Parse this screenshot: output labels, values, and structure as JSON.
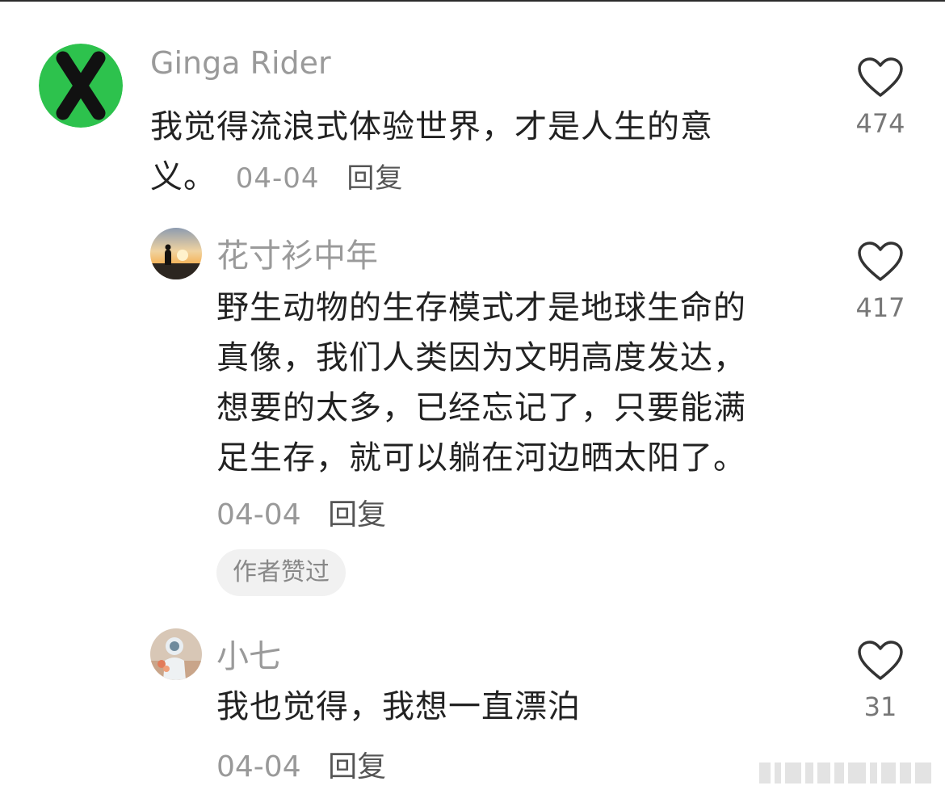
{
  "comments": [
    {
      "user": "Ginga Rider",
      "text_lines": [
        "我觉得流浪式体验世界，才是人生的意",
        "义。"
      ],
      "date": "04-04",
      "reply_label": "回复",
      "likes": "474",
      "avatar": "green-x-logo"
    },
    {
      "user": "花寸衫中年",
      "text_lines": [
        "野生动物的生存模式才是地球生命的",
        "真像，我们人类因为文明高度发达，",
        "想要的太多，已经忘记了，只要能满",
        "足生存，就可以躺在河边晒太阳了。"
      ],
      "date": "04-04",
      "reply_label": "回复",
      "likes": "417",
      "badge": "作者赞过",
      "avatar": "sunset-silhouette"
    },
    {
      "user": "小七",
      "text_lines": [
        "我也觉得，我想一直漂泊"
      ],
      "date": "04-04",
      "reply_label": "回复",
      "likes": "31",
      "avatar": "astronaut-photo"
    }
  ],
  "icons": {
    "like": "heart-outline-icon"
  },
  "colors": {
    "avatar_green": "#2dc24d",
    "text": "#222222",
    "muted": "#999999"
  }
}
